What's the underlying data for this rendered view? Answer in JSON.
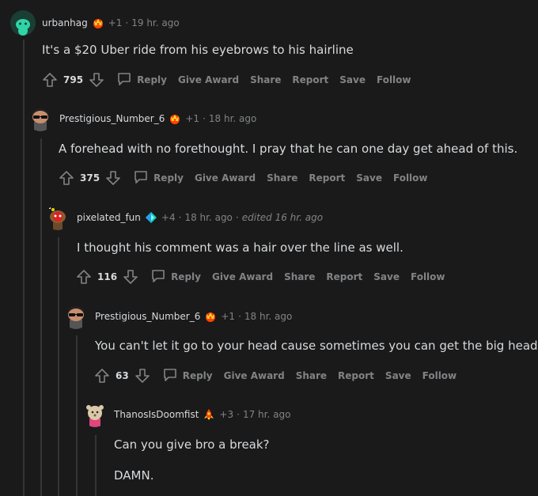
{
  "colors": {
    "background": "#1a1a1b",
    "text": "#d7dadc",
    "meta": "#818384",
    "thread": "#343536"
  },
  "actions": {
    "reply": "Reply",
    "give_award": "Give Award",
    "share": "Share",
    "report": "Report",
    "save": "Save",
    "follow": "Follow"
  },
  "comments": [
    {
      "username": "urbanhag",
      "karma": "+1",
      "sep": "·",
      "time": "19 hr. ago",
      "edited": "",
      "body": [
        "It's a $20 Uber ride from his eyebrows to his hairline"
      ],
      "score": "795",
      "flair_icon": "crown-badge-icon",
      "avatar_icon": "teal-snoo-avatar"
    },
    {
      "username": "Prestigious_Number_6",
      "karma": "+1",
      "sep": "·",
      "time": "18 hr. ago",
      "edited": "",
      "body": [
        "A forehead with no forethought. I pray that he can one day get ahead of this."
      ],
      "score": "375",
      "flair_icon": "crown-badge-icon",
      "avatar_icon": "sunglasses-snoo-avatar"
    },
    {
      "username": "pixelated_fun",
      "karma": "+4",
      "sep": "·",
      "time": "18 hr. ago",
      "edited": "edited 16 hr. ago",
      "body": [
        "I thought his comment was a hair over the line as well."
      ],
      "score": "116",
      "flair_icon": "diamond-icon",
      "avatar_icon": "red-mask-snoo-avatar"
    },
    {
      "username": "Prestigious_Number_6",
      "karma": "+1",
      "sep": "·",
      "time": "18 hr. ago",
      "edited": "",
      "body": [
        "You can't let it go to your head cause sometimes you can get the big head."
      ],
      "score": "63",
      "flair_icon": "crown-badge-icon",
      "avatar_icon": "sunglasses-snoo-avatar"
    },
    {
      "username": "ThanosIsDoomfist",
      "karma": "+3",
      "sep": "·",
      "time": "17 hr. ago",
      "edited": "",
      "body": [
        "Can you give bro a break?",
        "DAMN."
      ],
      "score": "",
      "flair_icon": "rocket-badge-icon",
      "avatar_icon": "bear-snoo-avatar"
    }
  ]
}
